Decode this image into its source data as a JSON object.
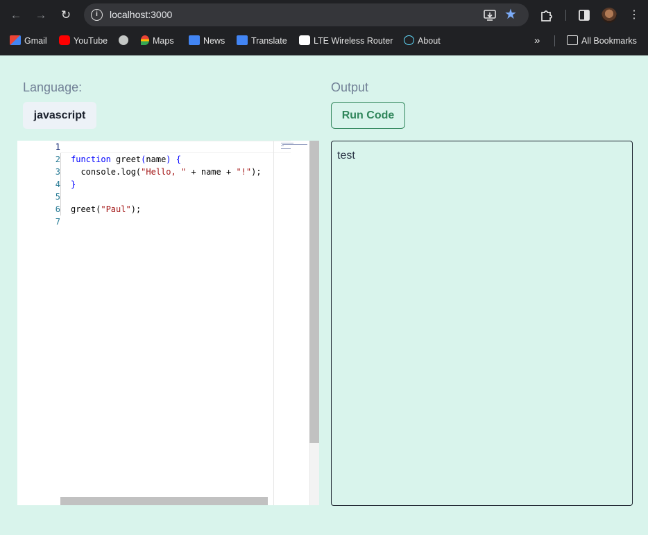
{
  "browser": {
    "url": "localhost:3000",
    "bookmarks": [
      {
        "label": "Gmail",
        "icon": "gmail-icon",
        "color": "#ea4335"
      },
      {
        "label": "YouTube",
        "icon": "youtube-icon",
        "color": "#ff0000"
      },
      {
        "label": "",
        "icon": "globe-icon",
        "color": "#c4c7c5"
      },
      {
        "label": "Maps",
        "icon": "maps-icon",
        "color": "#34a853"
      },
      {
        "label": "News",
        "icon": "news-icon",
        "color": "#4285f4"
      },
      {
        "label": "Translate",
        "icon": "translate-icon",
        "color": "#4285f4"
      },
      {
        "label": "LTE Wireless Router",
        "icon": "router-icon",
        "color": "#ffffff"
      },
      {
        "label": "About",
        "icon": "react-icon",
        "color": "#61dafb"
      }
    ],
    "all_bookmarks": "All Bookmarks"
  },
  "page": {
    "language_label": "Language:",
    "language_value": "javascript",
    "output_label": "Output",
    "run_button": "Run Code",
    "output_text": "test"
  },
  "editor": {
    "line_numbers": [
      "1",
      "2",
      "3",
      "4",
      "5",
      "6",
      "7"
    ],
    "lines": [
      "",
      "function greet(name) {",
      "  console.log(\"Hello, \" + name + \"!\");",
      "}",
      "",
      "greet(\"Paul\");",
      ""
    ]
  },
  "colors": {
    "page_bg": "#d9f4ec",
    "accent_green": "#2f855a",
    "keyword": "#0000ff",
    "string": "#a31515"
  }
}
